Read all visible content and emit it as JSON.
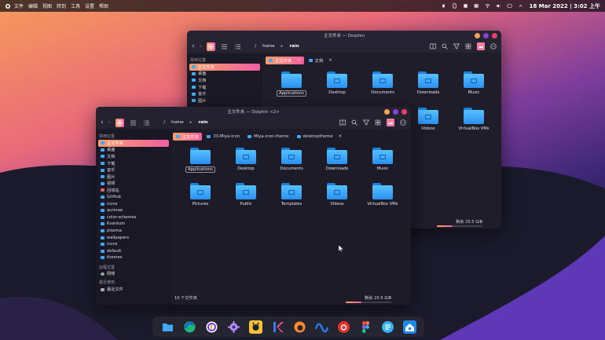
{
  "topbar": {
    "menu": [
      "文件",
      "编辑",
      "视图",
      "转到",
      "工具",
      "设置",
      "帮助"
    ],
    "clock": "18 Mar 2022 | 3:02 上午"
  },
  "back_window": {
    "title": "主文件夹 — Dolphin",
    "breadcrumb": [
      "/",
      "home",
      "rain"
    ],
    "sidebar_header": "常用位置",
    "sidebar": [
      "主文件夹",
      "桌面",
      "文档",
      "下载",
      "音乐",
      "图片"
    ],
    "tabs": [
      {
        "label": "主文件夹",
        "active": true
      },
      {
        "label": "文档",
        "active": false
      }
    ],
    "files": [
      "Applications",
      "Desktop",
      "Documents",
      "Downloads",
      "Music",
      "",
      "",
      "",
      "Videos",
      "VirtualBox VMs"
    ],
    "free": "剩余 25.5 GiB",
    "free_fraction": 0.35
  },
  "front_window": {
    "title": "主文件夹 — Dolphin <2>",
    "breadcrumb": [
      "/",
      "home",
      "rain"
    ],
    "sidebar_headers": [
      "常用位置",
      "远程位置",
      "最近使用"
    ],
    "sidebar_places": [
      "主文件夹",
      "桌面",
      "文档",
      "下载",
      "音乐",
      "图片",
      "视频",
      "回收站",
      "GitHub",
      "icons",
      "aurorae",
      "color-schemes",
      "Kvantum",
      "plasma",
      "wallpapers",
      "icons",
      "default",
      "themes"
    ],
    "sidebar_remote": [
      "网络"
    ],
    "sidebar_recent": [
      "最近文件"
    ],
    "tabs": [
      {
        "label": "主文件夹",
        "active": true
      },
      {
        "label": "33-Miya-icon",
        "active": false
      },
      {
        "label": "Miya-icon-theme",
        "active": false
      },
      {
        "label": "desktoptheme",
        "active": false
      }
    ],
    "files": [
      "Applications",
      "Desktop",
      "Documents",
      "Downloads",
      "Music",
      "Pictures",
      "Public",
      "Templates",
      "Videos",
      "VirtualBox VMs"
    ],
    "status": "10 个文件夹",
    "free": "剩余 25.5 GiB",
    "free_fraction": 0.35
  },
  "dock": [
    "files-icon",
    "edge-browser-icon",
    "music-app-icon",
    "settings-icon",
    "github-desktop-icon",
    "kdevelop-icon",
    "firefox-like-icon",
    "meta-icon",
    "netease-music-icon",
    "figma-icon",
    "notes-icon",
    "store-icon"
  ],
  "colors": {
    "accent_start": "#ff9f6a",
    "accent_end": "#f15fa0",
    "folder": "#3fa9f5"
  }
}
